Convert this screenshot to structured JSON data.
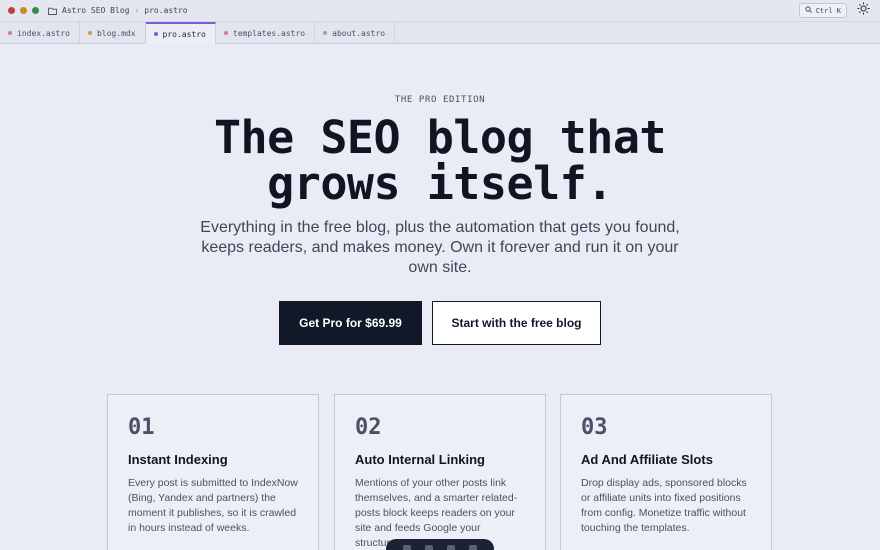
{
  "window": {
    "breadcrumb": [
      "Astro SEO Blog",
      "pro.astro"
    ],
    "search_label": "Ctrl K",
    "traffic_colors": [
      "#c0413b",
      "#c98a2a",
      "#3c8a4a"
    ]
  },
  "tabs": [
    {
      "label": "index.astro",
      "dot_color": "#d4779a",
      "active": false
    },
    {
      "label": "blog.mdx",
      "dot_color": "#d49a4a",
      "active": false
    },
    {
      "label": "pro.astro",
      "dot_color": "#7b5bd6",
      "active": true
    },
    {
      "label": "templates.astro",
      "dot_color": "#d4779a",
      "active": false
    },
    {
      "label": "about.astro",
      "dot_color": "#9aa0b0",
      "active": false
    }
  ],
  "hero": {
    "eyebrow": "THE PRO EDITION",
    "headline_line1": "The SEO blog that",
    "headline_line2": "grows itself.",
    "subtitle": "Everything in the free blog, plus the automation that gets you found, keeps readers, and makes money. Own it forever and run it on your own site.",
    "primary_cta": "Get Pro for $69.99",
    "secondary_cta": "Start with the free blog"
  },
  "features": [
    {
      "num": "01",
      "title": "Instant Indexing",
      "desc": "Every post is submitted to IndexNow (Bing, Yandex and partners) the moment it publishes, so it is crawled in hours instead of weeks."
    },
    {
      "num": "02",
      "title": "Auto Internal Linking",
      "desc": "Mentions of your other posts link themselves, and a smarter related-posts block keeps readers on your site and feeds Google your structure."
    },
    {
      "num": "03",
      "title": "Ad And Affiliate Slots",
      "desc": "Drop display ads, sponsored blocks or affiliate units into fixed positions from config. Monetize traffic without touching the templates."
    }
  ],
  "colors": {
    "accent": "#7b5bd6",
    "primary_button": "#111827",
    "background": "#e9ebf5"
  }
}
